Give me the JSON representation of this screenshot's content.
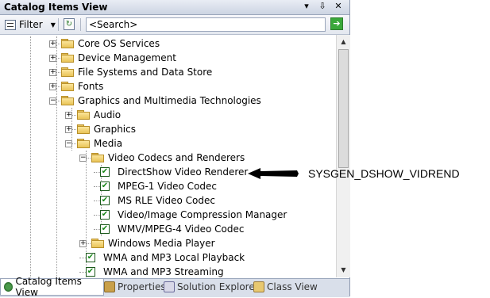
{
  "window": {
    "title": "Catalog Items View",
    "buttons": {
      "dropdown": "▾",
      "pin": "⇩",
      "close": "✕"
    }
  },
  "toolbar": {
    "filter_label": "Filter",
    "search_placeholder": "<Search>",
    "go_icon": "go-arrow-icon"
  },
  "tree": {
    "items": [
      {
        "label": "Core OS Services",
        "state": "collapsed"
      },
      {
        "label": "Device Management",
        "state": "collapsed"
      },
      {
        "label": "File Systems and Data Store",
        "state": "collapsed"
      },
      {
        "label": "Fonts",
        "state": "collapsed"
      },
      {
        "label": "Graphics and Multimedia Technologies",
        "state": "expanded"
      },
      {
        "label": "Audio",
        "state": "collapsed"
      },
      {
        "label": "Graphics",
        "state": "collapsed"
      },
      {
        "label": "Media",
        "state": "expanded"
      },
      {
        "label": "Video Codecs and Renderers",
        "state": "expanded"
      },
      {
        "label": "DirectShow Video Renderer",
        "checked": true
      },
      {
        "label": "MPEG-1 Video Codec",
        "checked": true
      },
      {
        "label": "MS RLE Video Codec",
        "checked": true
      },
      {
        "label": "Video/Image Compression Manager",
        "checked": true
      },
      {
        "label": "WMV/MPEG-4 Video Codec",
        "checked": true
      },
      {
        "label": "Windows Media Player",
        "state": "collapsed"
      },
      {
        "label": "WMA and MP3 Local Playback",
        "checked": true
      },
      {
        "label": "WMA and MP3 Streaming",
        "checked": true
      }
    ]
  },
  "tabs": [
    {
      "label": "Catalog Items View",
      "active": true
    },
    {
      "label": "Properties",
      "active": false
    },
    {
      "label": "Solution Explorer",
      "active": false
    },
    {
      "label": "Class View",
      "active": false
    }
  ],
  "annotation": {
    "label": "SYSGEN_DSHOW_VIDREND"
  },
  "colors": {
    "folder": "#f0cf6a",
    "check": "#1a8a1a",
    "go_button": "#3aa83a"
  }
}
